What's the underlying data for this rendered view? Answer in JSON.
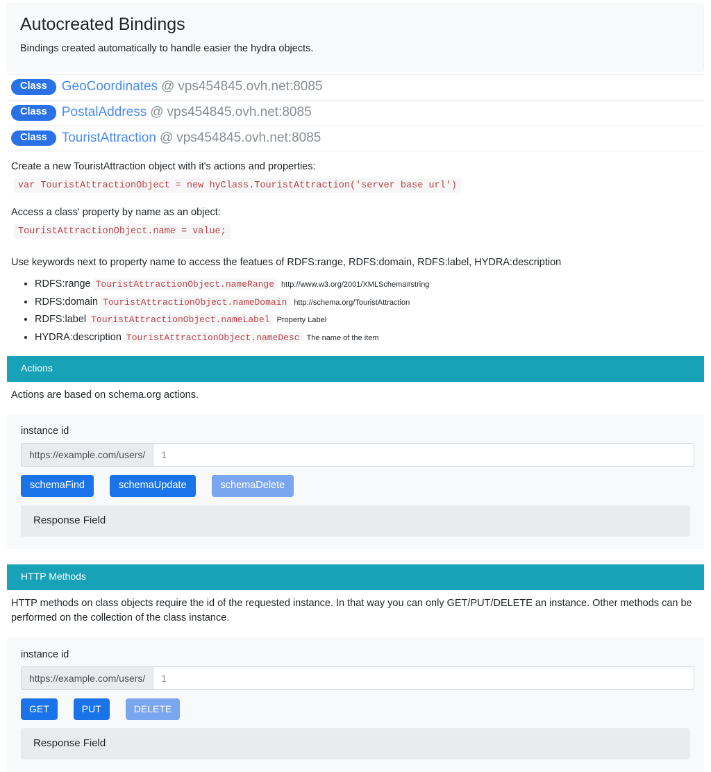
{
  "header": {
    "title": "Autocreated Bindings",
    "subtitle": "Bindings created automatically to handle easier the hydra objects."
  },
  "classes": [
    {
      "badge": "Class",
      "name": "GeoCoordinates",
      "separator": "@",
      "host": "vps454845.ovh.net:8085"
    },
    {
      "badge": "Class",
      "name": "PostalAddress",
      "separator": "@",
      "host": "vps454845.ovh.net:8085"
    },
    {
      "badge": "Class",
      "name": "TouristAttraction",
      "separator": "@",
      "host": "vps454845.ovh.net:8085"
    }
  ],
  "docs": {
    "create_text": "Create a new TouristAttraction object with it's actions and properties:",
    "create_code": "var TouristAttractionObject = new hyClass.TouristAttraction('server base url')",
    "access_text": "Access a class' property by name as an object:",
    "access_code": "TouristAttractionObject.name = value;",
    "keywords_text": "Use keywords next to property name to access the featues of RDFS:range, RDFS:domain, RDFS:label, HYDRA:description",
    "keywords": [
      {
        "label": "RDFS:range",
        "code": "TouristAttractionObject.nameRange",
        "note": "http://www.w3.org/2001/XMLSchema#string"
      },
      {
        "label": "RDFS:domain",
        "code": "TouristAttractionObject.nameDomain",
        "note": "http://schema.org/TouristAttraction"
      },
      {
        "label": "RDFS:label",
        "code": "TouristAttractionObject.nameLabel",
        "note": "Property Label"
      },
      {
        "label": "HYDRA:description",
        "code": "TouristAttractionObject.nameDesc",
        "note": "The name of the item"
      }
    ]
  },
  "actions": {
    "header": "Actions",
    "intro": "Actions are based on schema.org actions.",
    "instance_label": "instance id",
    "addon": "https://example.com/users/",
    "input_value": "1",
    "input_placeholder": "1",
    "buttons": [
      {
        "label": "schemaFind",
        "state": "active"
      },
      {
        "label": "schemaUpdate",
        "state": "active"
      },
      {
        "label": "schemaDelete",
        "state": "faded"
      }
    ],
    "response_field": "Response Field"
  },
  "http_methods": {
    "header": "HTTP Methods",
    "intro": "HTTP methods on class objects require the id of the requested instance. In that way you can only GET/PUT/DELETE an instance. Other methods can be performed on the collection of the class instance.",
    "instance_label": "instance id",
    "addon": "https://example.com/users/",
    "input_value": "1",
    "input_placeholder": "1",
    "buttons": [
      {
        "label": "GET",
        "state": "active"
      },
      {
        "label": "PUT",
        "state": "active"
      },
      {
        "label": "DELETE",
        "state": "faded"
      }
    ],
    "response_field": "Response Field"
  },
  "colors": {
    "section_header_bg": "#17a2b8",
    "badge_bg": "#2a71e8",
    "button_bg": "#1a73e8",
    "button_faded_bg": "#7aa6f0",
    "link": "#4a8af4",
    "code_text": "#bd4147",
    "panel_bg": "#f8f9fa",
    "response_bg": "#e9ecef"
  }
}
